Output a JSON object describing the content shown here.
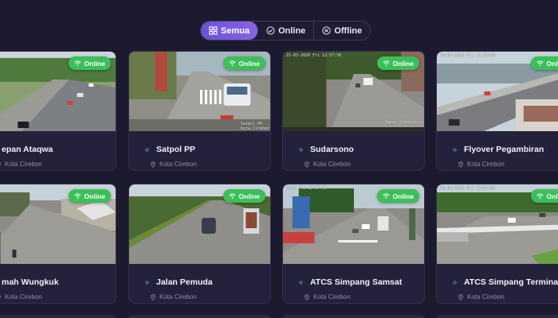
{
  "filters": {
    "all_label": "Semua",
    "online_label": "Online",
    "offline_label": "Offline",
    "active": "all"
  },
  "colors": {
    "background": "#1c1a2e",
    "card": "#24223a",
    "accent": "#7a5ae0",
    "online_badge": "#3bbf59"
  },
  "cameras": [
    {
      "title": "epan Ataqwa",
      "location": "Kota Cirebon",
      "status": "Online",
      "stamp": ""
    },
    {
      "title": "Satpol PP",
      "location": "Kota Cirebon",
      "status": "Online",
      "stamp": ""
    },
    {
      "title": "Sudarsono",
      "location": "Kota Cirebon",
      "status": "Online",
      "stamp": ""
    },
    {
      "title": "Flyover Pegambiran",
      "location": "Kota Cirebon",
      "status": "Online",
      "stamp": ""
    },
    {
      "title": "mah Wungkuk",
      "location": "Kota Cirebon",
      "status": "Online",
      "stamp": ""
    },
    {
      "title": "Jalan Pemuda",
      "location": "Kota Cirebon",
      "status": "Online",
      "stamp": ""
    },
    {
      "title": "ATCS Simpang Samsat",
      "location": "Kota Cirebon",
      "status": "Online",
      "stamp": "2026 Fri 12:57:56"
    },
    {
      "title": "ATCS Simpang Terminal",
      "location": "Kota Cirebon",
      "status": "Online",
      "stamp": "20-03-2026 Fri 12:57:56"
    }
  ]
}
